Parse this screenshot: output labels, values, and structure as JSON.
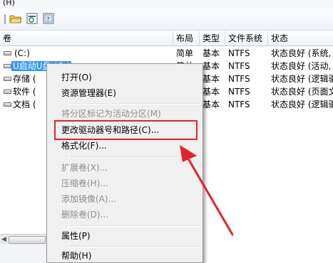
{
  "menubar": {
    "fragment": "(H)"
  },
  "toolbar": {
    "icons": [
      "separator-icon",
      "open-folder-icon",
      "properties-icon",
      "help-icon"
    ]
  },
  "table": {
    "headers": [
      "卷",
      "布局",
      "类型",
      "文件系统",
      "状态"
    ],
    "rows": [
      {
        "name": "(C:)",
        "layout": "简单",
        "type": "基本",
        "fs": "NTFS",
        "status": "状态良好 (系统,",
        "selected": false
      },
      {
        "name": "U启动U盘 (G:)",
        "layout": "简单",
        "type": "基本",
        "fs": "NTFS",
        "status": "状态良好 (活动,",
        "selected": true
      },
      {
        "name": "存储 (",
        "layout": "简单",
        "type": "基本",
        "fs": "NTFS",
        "status": "状态良好 (逻辑驱",
        "selected": false
      },
      {
        "name": "软件 (",
        "layout": "简单",
        "type": "基本",
        "fs": "NTFS",
        "status": "状态良好 (页面文",
        "selected": false
      },
      {
        "name": "文档 (",
        "layout": "简单",
        "type": "基本",
        "fs": "NTFS",
        "status": "状态良好 (逻辑驱",
        "selected": false
      }
    ]
  },
  "context_menu": {
    "items": [
      {
        "label": "打开(O)",
        "disabled": false
      },
      {
        "label": "资源管理器(E)",
        "disabled": false
      },
      {
        "label": "将分区标记为活动分区(M)",
        "disabled": true
      },
      {
        "label": "更改驱动器号和路径(C)...",
        "disabled": false,
        "highlighted": true
      },
      {
        "label": "格式化(F)...",
        "disabled": false
      },
      {
        "label": "扩展卷(X)...",
        "disabled": true
      },
      {
        "label": "压缩卷(H)...",
        "disabled": true
      },
      {
        "label": "添加镜像(A)...",
        "disabled": true
      },
      {
        "label": "删除卷(D)...",
        "disabled": true
      },
      {
        "label": "属性(P)",
        "disabled": false
      },
      {
        "label": "帮助(H)",
        "disabled": false
      }
    ]
  },
  "colors": {
    "selection": "#3399ff",
    "annotation_red": "#e1242a"
  }
}
